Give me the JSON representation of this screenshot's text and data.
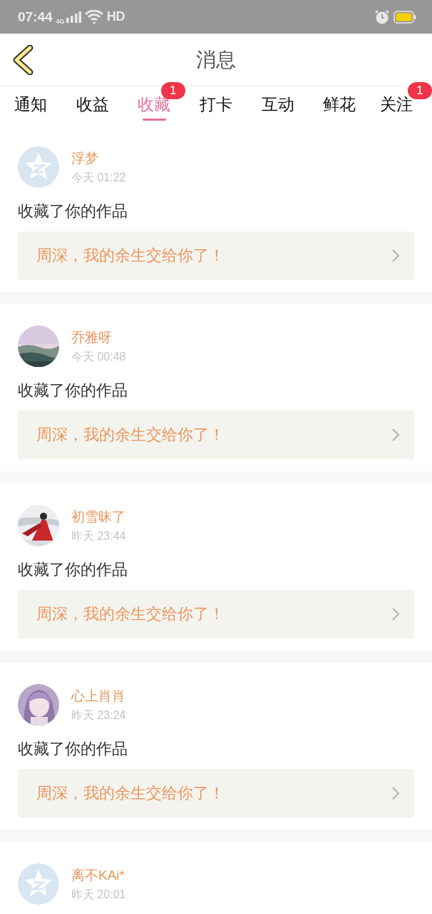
{
  "status_bar": {
    "time": "07:44",
    "network": "4G",
    "wifi_label": "HD"
  },
  "header": {
    "title": "消息"
  },
  "tabs": [
    {
      "label": "通知",
      "selected": false
    },
    {
      "label": "收益",
      "selected": false
    },
    {
      "label": "收藏",
      "selected": true,
      "badge": "1"
    },
    {
      "label": "打卡",
      "selected": false
    },
    {
      "label": "互动",
      "selected": false
    },
    {
      "label": "鲜花",
      "selected": false
    },
    {
      "label": "关注",
      "selected": false,
      "badge": "1"
    }
  ],
  "messages": [
    {
      "avatar": {
        "kind": "default"
      },
      "name": "浮梦",
      "time": "今天 01:22",
      "action": "收藏了你的作品",
      "work": "周深，我的余生交给你了！"
    },
    {
      "name": "乔雅呀",
      "time": "今天 00:48",
      "action": "收藏了你的作品",
      "work": "周深，我的余生交给你了！"
    },
    {
      "name": "初雪昧了",
      "time": "昨天 23:44",
      "action": "收藏了你的作品",
      "work": "周深，我的余生交给你了！"
    },
    {
      "name": "心上肖肖",
      "time": "昨天 23:24",
      "action": "收藏了你的作品",
      "work": "周深，我的余生交给你了！"
    },
    {
      "avatar": {
        "kind": "default"
      },
      "name": "离不KAi*",
      "time": "昨天 20:01"
    }
  ]
}
